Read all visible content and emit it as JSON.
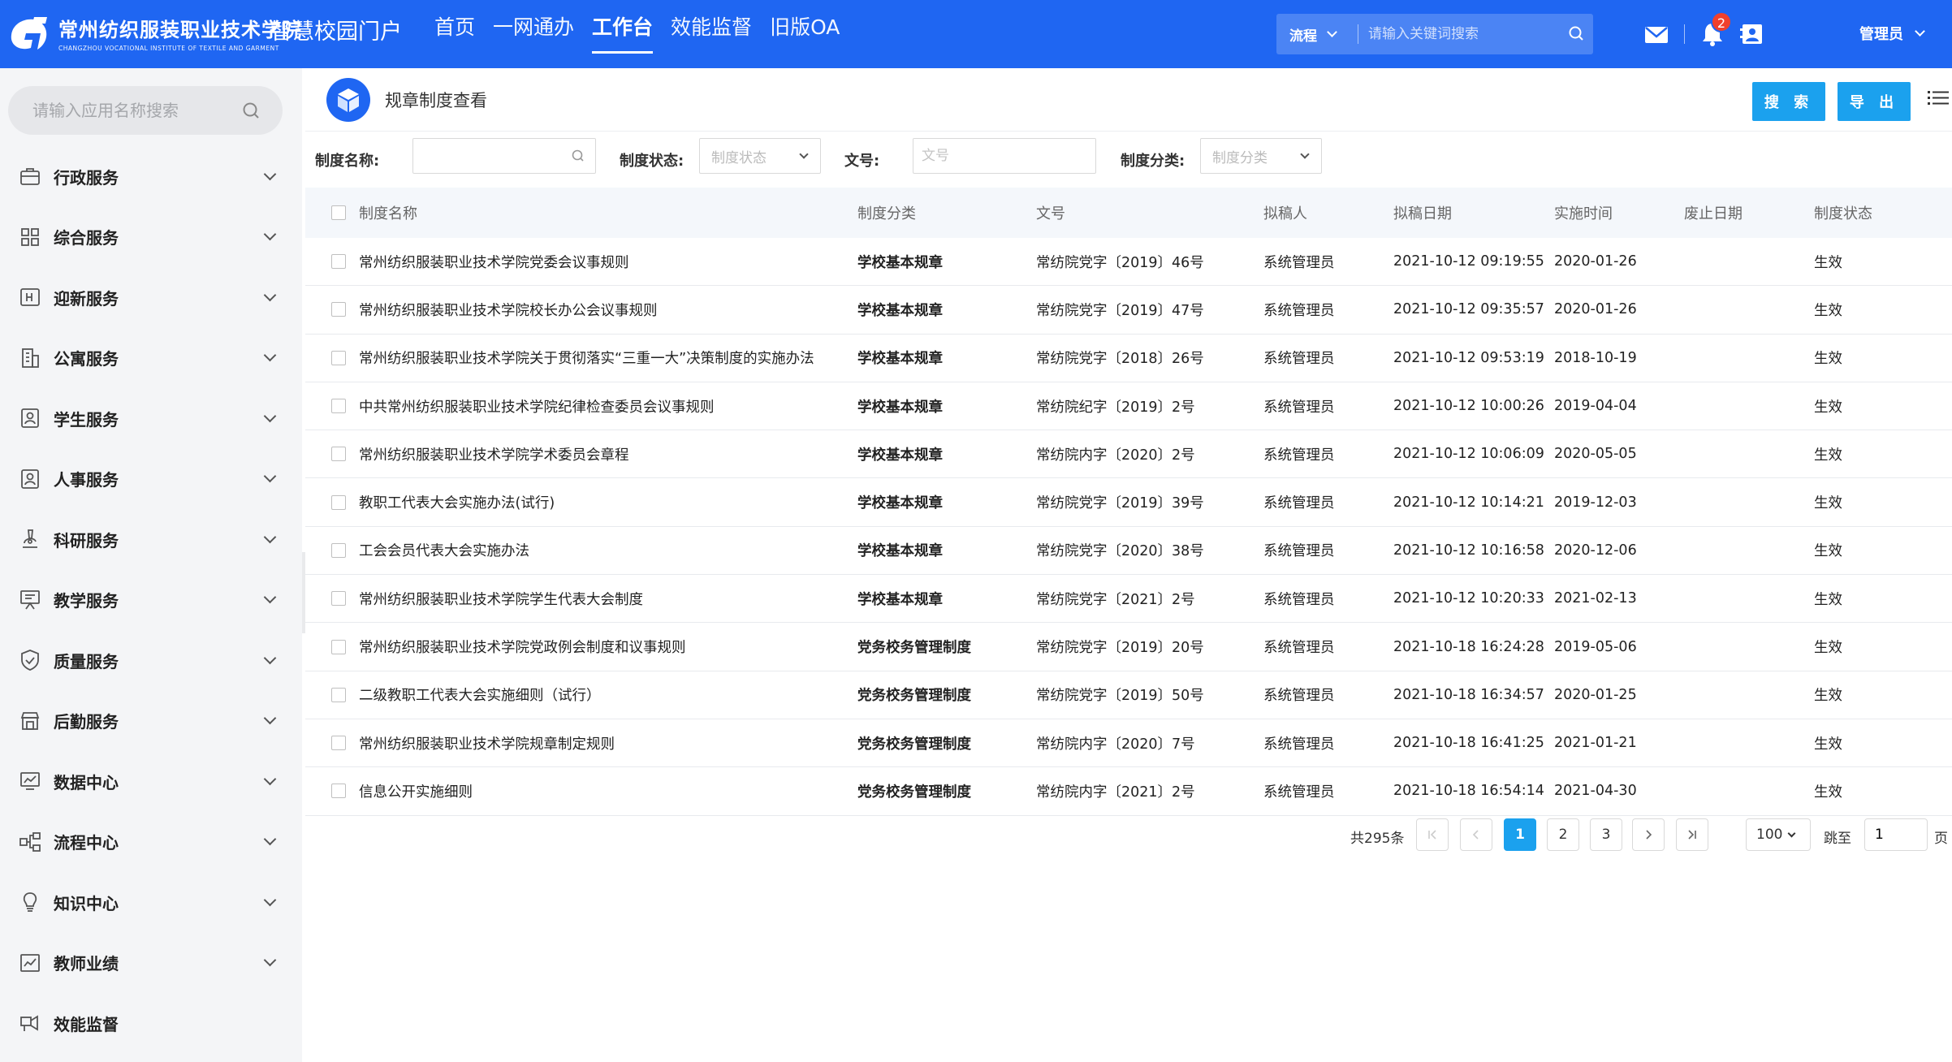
{
  "header": {
    "school_name": "常州纺织服装职业技术学院",
    "school_name_en": "CHANGZHOU VOCATIONAL INSTITUTE OF TEXTILE AND GARMENT",
    "portal_title": "智慧校园门户",
    "nav": [
      {
        "label": "首页",
        "active": false
      },
      {
        "label": "一网通办",
        "active": false
      },
      {
        "label": "工作台",
        "active": true
      },
      {
        "label": "效能监督",
        "active": false
      },
      {
        "label": "旧版OA",
        "active": false
      }
    ],
    "search": {
      "type": "流程",
      "placeholder": "请输入关键词搜索"
    },
    "notification_count": "2",
    "user": "管理员",
    "colors": {
      "primary": "#1f66f2",
      "accent": "#1ba1ee",
      "badge": "#f0402c"
    }
  },
  "sidebar": {
    "search_placeholder": "请输入应用名称搜索",
    "items": [
      {
        "label": "行政服务",
        "icon": "briefcase-icon",
        "expandable": true
      },
      {
        "label": "综合服务",
        "icon": "grid-icon",
        "expandable": true
      },
      {
        "label": "迎新服务",
        "icon": "welcome-icon",
        "expandable": true
      },
      {
        "label": "公寓服务",
        "icon": "building-icon",
        "expandable": true
      },
      {
        "label": "学生服务",
        "icon": "student-icon",
        "expandable": true
      },
      {
        "label": "人事服务",
        "icon": "person-icon",
        "expandable": true
      },
      {
        "label": "科研服务",
        "icon": "microscope-icon",
        "expandable": true
      },
      {
        "label": "教学服务",
        "icon": "teaching-icon",
        "expandable": true
      },
      {
        "label": "质量服务",
        "icon": "shield-check-icon",
        "expandable": true
      },
      {
        "label": "后勤服务",
        "icon": "store-icon",
        "expandable": true
      },
      {
        "label": "数据中心",
        "icon": "chart-monitor-icon",
        "expandable": true
      },
      {
        "label": "流程中心",
        "icon": "flow-icon",
        "expandable": true
      },
      {
        "label": "知识中心",
        "icon": "bulb-icon",
        "expandable": true
      },
      {
        "label": "教师业绩",
        "icon": "trend-icon",
        "expandable": true
      },
      {
        "label": "效能监督",
        "icon": "monitor-icon",
        "expandable": false
      }
    ]
  },
  "page": {
    "title": "规章制度查看",
    "search_button": "搜 索",
    "export_button": "导 出"
  },
  "filters": {
    "name_label": "制度名称:",
    "name_value": "",
    "status_label": "制度状态:",
    "status_placeholder": "制度状态",
    "doc_label": "文号:",
    "doc_placeholder": "文号",
    "category_label": "制度分类:",
    "category_placeholder": "制度分类"
  },
  "table": {
    "columns": [
      "制度名称",
      "制度分类",
      "文号",
      "拟稿人",
      "拟稿日期",
      "实施时间",
      "废止日期",
      "制度状态"
    ],
    "rows": [
      [
        "常州纺织服装职业技术学院党委会议事规则",
        "学校基本规章",
        "常纺院党字〔2019〕46号",
        "系统管理员",
        "2021-10-12 09:19:55",
        "2020-01-26",
        "",
        "生效"
      ],
      [
        "常州纺织服装职业技术学院校长办公会议事规则",
        "学校基本规章",
        "常纺院党字〔2019〕47号",
        "系统管理员",
        "2021-10-12 09:35:57",
        "2020-01-26",
        "",
        "生效"
      ],
      [
        "常州纺织服装职业技术学院关于贯彻落实“三重一大”决策制度的实施办法",
        "学校基本规章",
        "常纺院党字〔2018〕26号",
        "系统管理员",
        "2021-10-12 09:53:19",
        "2018-10-19",
        "",
        "生效"
      ],
      [
        "中共常州纺织服装职业技术学院纪律检查委员会议事规则",
        "学校基本规章",
        "常纺院纪字〔2019〕2号",
        "系统管理员",
        "2021-10-12 10:00:26",
        "2019-04-04",
        "",
        "生效"
      ],
      [
        "常州纺织服装职业技术学院学术委员会章程",
        "学校基本规章",
        "常纺院内字〔2020〕2号",
        "系统管理员",
        "2021-10-12 10:06:09",
        "2020-05-05",
        "",
        "生效"
      ],
      [
        "教职工代表大会实施办法(试行)",
        "学校基本规章",
        "常纺院党字〔2019〕39号",
        "系统管理员",
        "2021-10-12 10:14:21",
        "2019-12-03",
        "",
        "生效"
      ],
      [
        "工会会员代表大会实施办法",
        "学校基本规章",
        "常纺院党字〔2020〕38号",
        "系统管理员",
        "2021-10-12 10:16:58",
        "2020-12-06",
        "",
        "生效"
      ],
      [
        "常州纺织服装职业技术学院学生代表大会制度",
        "学校基本规章",
        "常纺院党字〔2021〕2号",
        "系统管理员",
        "2021-10-12 10:20:33",
        "2021-02-13",
        "",
        "生效"
      ],
      [
        "常州纺织服装职业技术学院党政例会制度和议事规则",
        "党务校务管理制度",
        "常纺院党字〔2019〕20号",
        "系统管理员",
        "2021-10-18 16:24:28",
        "2019-05-06",
        "",
        "生效"
      ],
      [
        "二级教职工代表大会实施细则（试行）",
        "党务校务管理制度",
        "常纺院党字〔2019〕50号",
        "系统管理员",
        "2021-10-18 16:34:57",
        "2020-01-25",
        "",
        "生效"
      ],
      [
        "常州纺织服装职业技术学院规章制定规则",
        "党务校务管理制度",
        "常纺院内字〔2020〕7号",
        "系统管理员",
        "2021-10-18 16:41:25",
        "2021-01-21",
        "",
        "生效"
      ],
      [
        "信息公开实施细则",
        "党务校务管理制度",
        "常纺院内字〔2021〕2号",
        "系统管理员",
        "2021-10-18 16:54:14",
        "2021-04-30",
        "",
        "生效"
      ]
    ]
  },
  "pagination": {
    "total": "共295条",
    "pages": [
      "1",
      "2",
      "3"
    ],
    "current": "1",
    "page_size": "100",
    "jump_label": "跳至",
    "jump_value": "1",
    "unit": "页"
  }
}
